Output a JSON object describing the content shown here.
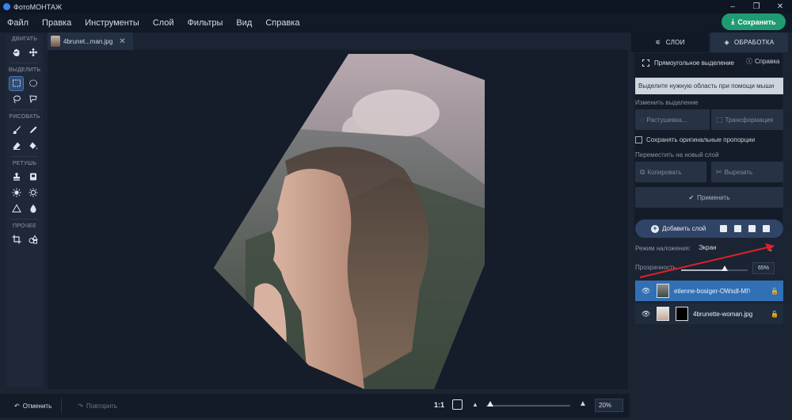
{
  "app": {
    "title": "ФотоМОНТАЖ"
  },
  "menu": [
    "Файл",
    "Правка",
    "Инструменты",
    "Слой",
    "Фильтры",
    "Вид",
    "Справка"
  ],
  "save_button": "Сохранить",
  "toolbar": {
    "sections": [
      {
        "label": "ДВИГАТЬ",
        "tools": [
          "hand-icon",
          "move-icon"
        ]
      },
      {
        "label": "ВЫДЕЛИТЬ",
        "tools": [
          "rect-select-icon",
          "ellipse-select-icon",
          "lasso-icon",
          "polygon-lasso-icon"
        ]
      },
      {
        "label": "РИСОВАТЬ",
        "tools": [
          "brush-icon",
          "pencil-icon",
          "eraser-icon",
          "fill-icon"
        ]
      },
      {
        "label": "РЕТУШЬ",
        "tools": [
          "stamp-icon",
          "patch-icon",
          "brightness-icon",
          "exposure-icon",
          "sharpen-icon",
          "blur-icon"
        ]
      },
      {
        "label": "ПРОЧЕЕ",
        "tools": [
          "crop-icon",
          "shapes-icon"
        ]
      }
    ]
  },
  "document_tab": {
    "name": "4brunet...man.jpg"
  },
  "bottom": {
    "undo": "Отменить",
    "redo": "Повторить",
    "ratio": "1:1",
    "zoom_percent": "20%",
    "zoom_level": 0.05
  },
  "panel": {
    "tab_layers": "СЛОИ",
    "tab_processing": "ОБРАБОТКА",
    "selection_tool": "Прямоугольное выделение",
    "help": "Справка",
    "hint": "Выделите нужную область при помощи мыши",
    "change_selection": "Изменить выделение",
    "feather": "Растушевка...",
    "transform": "Трансформация",
    "keep_proportions": "Сохранять оригинальные пропорции",
    "move_to_new_layer": "Переместить на новый слой",
    "copy": "Копировать",
    "cut": "Вырезать",
    "apply": "Применить",
    "add_layer": "Добавить слой",
    "blend_label": "Режим наложения:",
    "blend_value": "Экран",
    "opacity_label": "Прозрачность",
    "opacity_value": "65%",
    "opacity_level": 0.65,
    "layers": [
      {
        "name": "etienne-bosiger-OWsdl-MIYA-c",
        "selected": true
      },
      {
        "name": "4brunette-woman.jpg",
        "selected": false
      }
    ]
  },
  "colors": {
    "accent": "#1f9b72",
    "selected_layer": "#3170b5",
    "annotation_arrow": "#e0202a"
  }
}
